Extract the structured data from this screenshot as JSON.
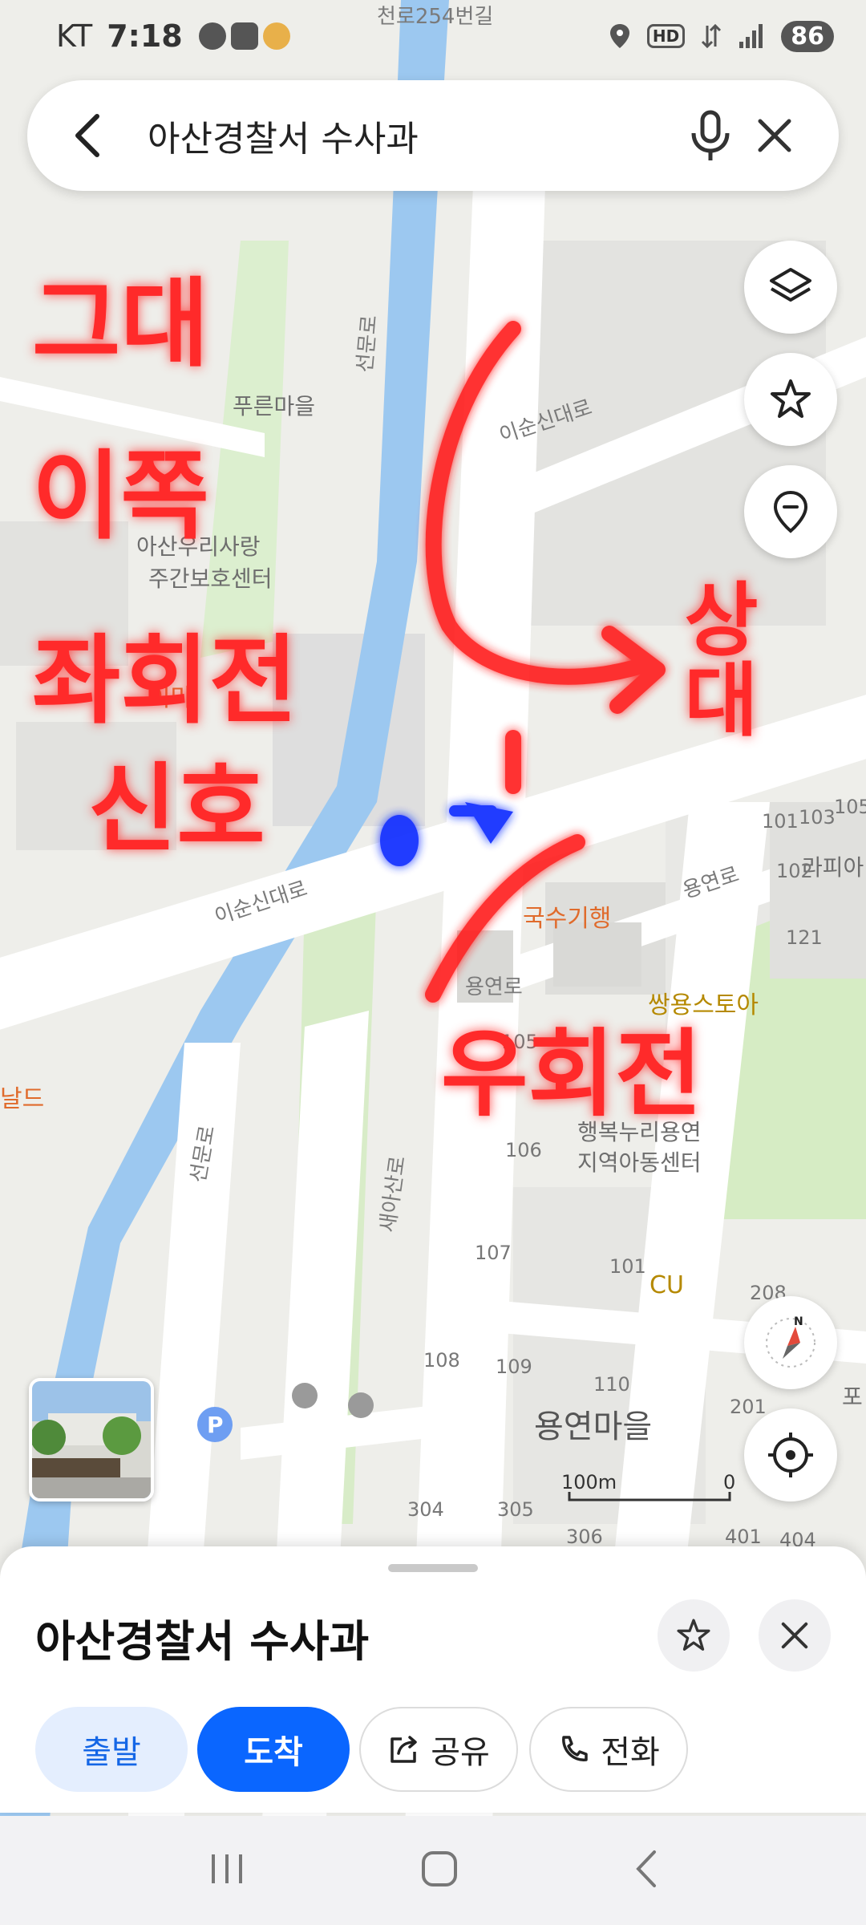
{
  "status_bar": {
    "carrier": "KT",
    "time": "7:18",
    "battery": "86",
    "icons": [
      "talk-icon",
      "bank-icon",
      "character-icon",
      "location-icon",
      "hd-icon",
      "data-icon",
      "signal-icon"
    ]
  },
  "search": {
    "query": "아산경찰서 수사과"
  },
  "map": {
    "road_labels": [
      "이순신대로",
      "이순신대로",
      "선문로",
      "선문로",
      "용연로",
      "용연로",
      "새아산로",
      "천로254번길"
    ],
    "place_labels": [
      "푸른마을",
      "아산우리사랑",
      "주간보호센터",
      "국수기행",
      "쌍용스토아",
      "CU",
      "용연마을",
      "행복누리용연",
      "지역아동센터",
      "라피아",
      "날드",
      "이마"
    ],
    "building_numbers": [
      "101",
      "103",
      "105",
      "102",
      "121",
      "105",
      "106",
      "107",
      "101",
      "208",
      "108",
      "109",
      "110",
      "201",
      "304",
      "305",
      "306",
      "401",
      "404",
      "포"
    ],
    "scale": {
      "label": "100m",
      "zero": "0"
    },
    "annotations": {
      "left_text": [
        "그대",
        "이쪽",
        "좌회전",
        "신호"
      ],
      "right_text": [
        "상대"
      ],
      "bottom_text": "우회전"
    }
  },
  "sheet": {
    "title": "아산경찰서 수사과",
    "buttons": {
      "start": "출발",
      "arrive": "도착",
      "share": "공유",
      "call": "전화"
    }
  },
  "colors": {
    "accent": "#0a66ff",
    "annotation_red": "#ff1e1e",
    "annotation_blue": "#1433ff",
    "water": "#9cc8f0",
    "park": "#d6ecc4"
  }
}
